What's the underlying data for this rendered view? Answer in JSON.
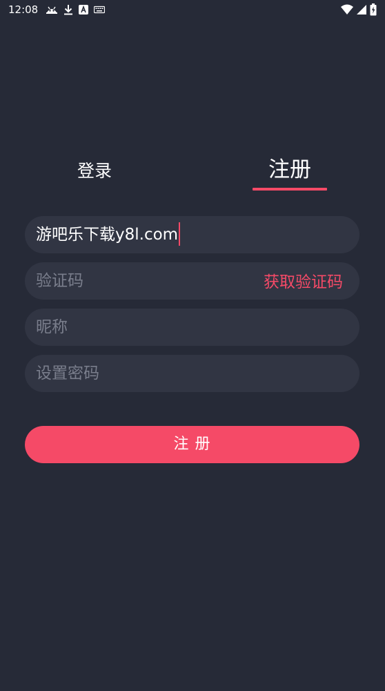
{
  "status_bar": {
    "time": "12:08",
    "left_icons": [
      "android-debug-icon",
      "download-icon",
      "app-a-icon",
      "keyboard-icon"
    ],
    "right_icons": [
      "wifi-icon",
      "signal-icon",
      "battery-icon"
    ]
  },
  "tabs": {
    "login_label": "登录",
    "register_label": "注册",
    "active": "register"
  },
  "form": {
    "phone_value": "游吧乐下载y8l.com",
    "code_placeholder": "验证码",
    "get_code_label": "获取验证码",
    "nickname_placeholder": "昵称",
    "password_placeholder": "设置密码"
  },
  "submit": {
    "label": "注 册"
  },
  "colors": {
    "background": "#262a37",
    "field_background": "#313543",
    "accent": "#f54a67",
    "placeholder": "#7a7e8c"
  }
}
